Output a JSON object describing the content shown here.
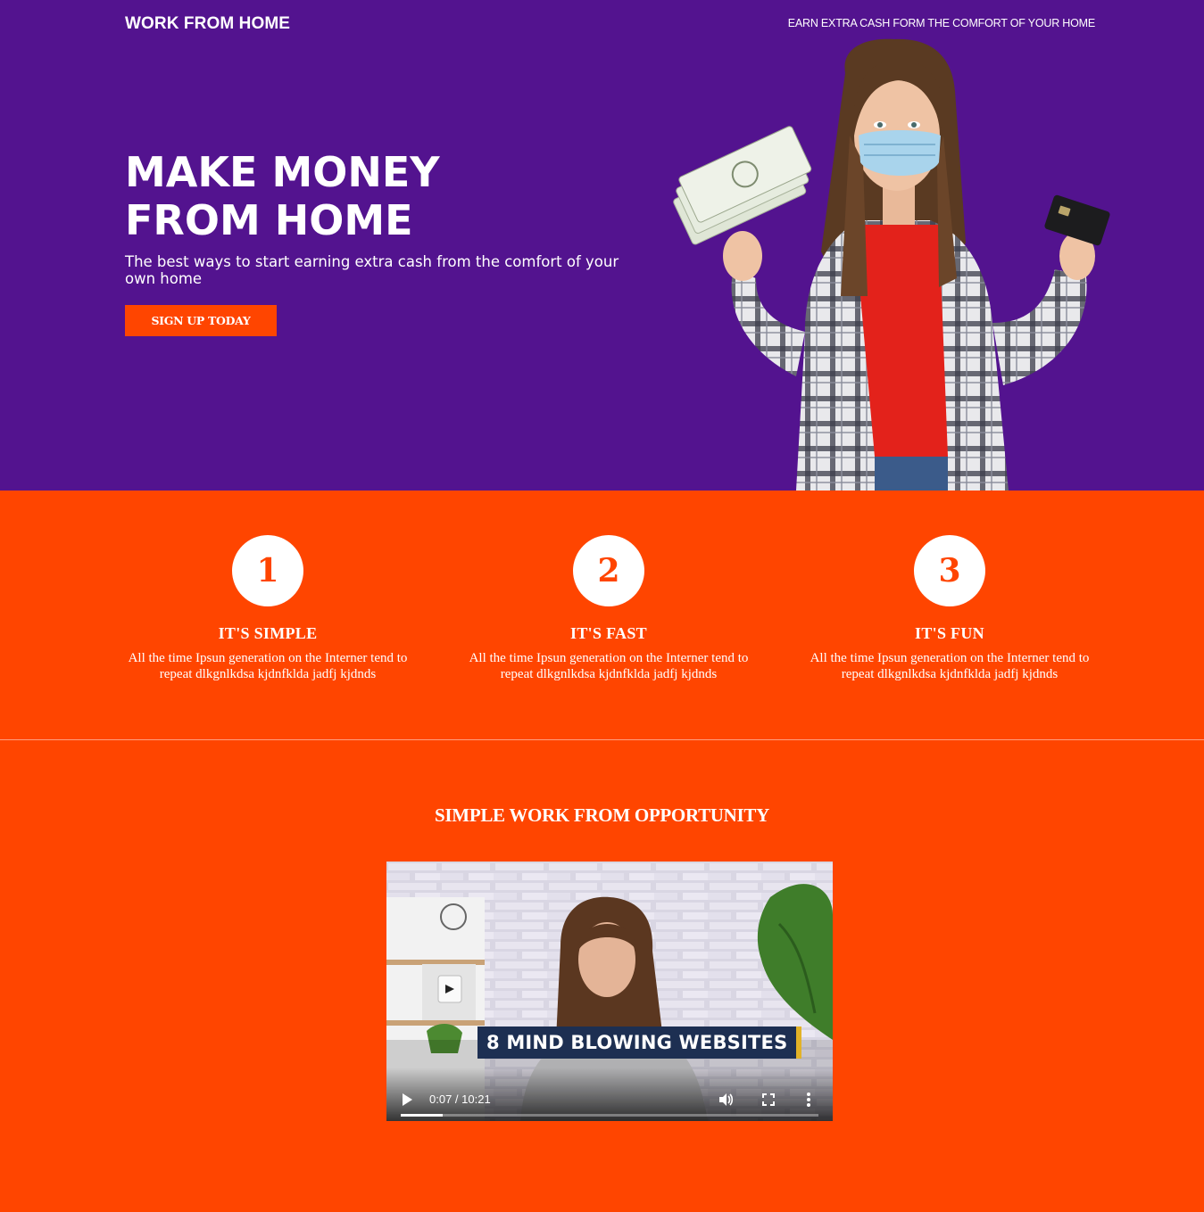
{
  "header": {
    "brand": "WORK FROM HOME",
    "tagline": "EARN EXTRA CASH FORM THE COMFORT OF YOUR HOME"
  },
  "hero": {
    "headline_line1": "MAKE MONEY",
    "headline_line2": "FROM HOME",
    "subheadline": "The best ways to start earning extra cash from the comfort of your own home",
    "cta_label": "SIGN UP TODAY"
  },
  "features": [
    {
      "number": "1",
      "title": "IT'S SIMPLE",
      "text": "All the time Ipsun generation on the Interner tend to repeat dlkgnlkdsa kjdnfklda jadfj kjdnds"
    },
    {
      "number": "2",
      "title": "IT'S FAST",
      "text": "All the time Ipsun generation on the Interner tend to repeat dlkgnlkdsa kjdnfklda jadfj kjdnds"
    },
    {
      "number": "3",
      "title": "IT'S FUN",
      "text": "All the time Ipsun generation on the Interner tend to repeat dlkgnlkdsa kjdnfklda jadfj kjdnds"
    }
  ],
  "video_section": {
    "title": "SIMPLE WORK FROM OPPORTUNITY",
    "video": {
      "banner_text": "8 MIND BLOWING WEBSITES",
      "time_display": "0:07 / 10:21",
      "progress_fraction": 0.1
    }
  },
  "colors": {
    "hero_background": "#53138f",
    "accent_orange": "#ff4500",
    "text_white": "#ffffff"
  },
  "icons": {
    "play": "play-icon",
    "volume": "volume-icon",
    "fullscreen": "fullscreen-icon",
    "menu": "more-vertical-icon"
  }
}
